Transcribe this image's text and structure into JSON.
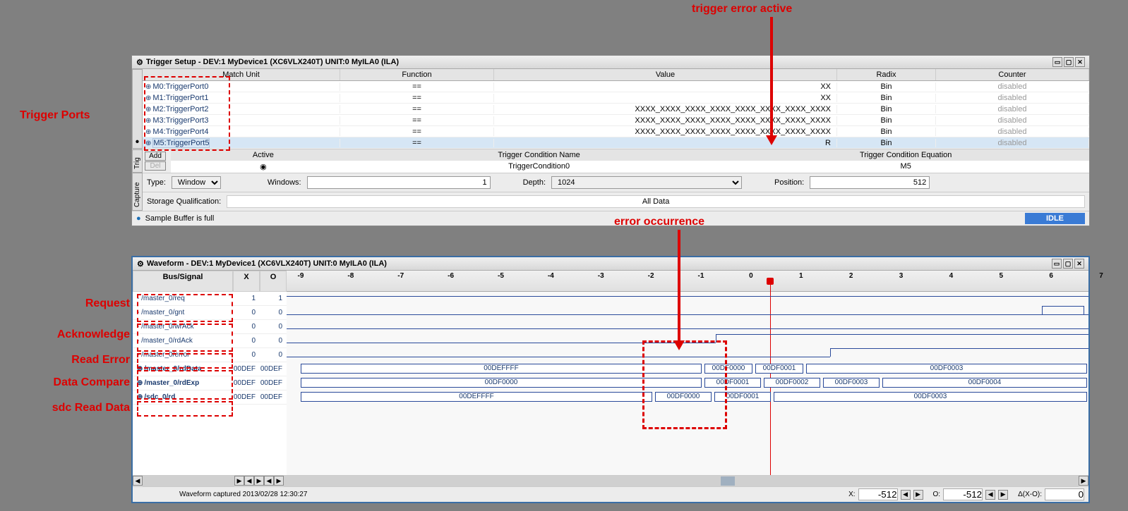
{
  "annotations": {
    "trigger_error": "trigger error active",
    "trigger_ports": "Trigger Ports",
    "error_occurrence": "error occurrence",
    "request": "Request",
    "acknowledge": "Acknowledge",
    "read_error": "Read Error",
    "data_compare": "Data Compare",
    "sdc_read_data": "sdc Read Data"
  },
  "trigger": {
    "title": "Trigger Setup - DEV:1 MyDevice1 (XC6VLX240T) UNIT:0 MyILA0 (ILA)",
    "headers": {
      "mu": "Match Unit",
      "fn": "Function",
      "val": "Value",
      "rx": "Radix",
      "cnt": "Counter"
    },
    "rows": [
      {
        "mu": "M0:TriggerPort0",
        "fn": "==",
        "val": "XX",
        "rx": "Bin",
        "cnt": "disabled"
      },
      {
        "mu": "M1:TriggerPort1",
        "fn": "==",
        "val": "XX",
        "rx": "Bin",
        "cnt": "disabled"
      },
      {
        "mu": "M2:TriggerPort2",
        "fn": "==",
        "val": "XXXX_XXXX_XXXX_XXXX_XXXX_XXXX_XXXX_XXXX",
        "rx": "Bin",
        "cnt": "disabled"
      },
      {
        "mu": "M3:TriggerPort3",
        "fn": "==",
        "val": "XXXX_XXXX_XXXX_XXXX_XXXX_XXXX_XXXX_XXXX",
        "rx": "Bin",
        "cnt": "disabled"
      },
      {
        "mu": "M4:TriggerPort4",
        "fn": "==",
        "val": "XXXX_XXXX_XXXX_XXXX_XXXX_XXXX_XXXX_XXXX",
        "rx": "Bin",
        "cnt": "disabled"
      },
      {
        "mu": "M5:TriggerPort5",
        "fn": "==",
        "val": "R",
        "rx": "Bin",
        "cnt": "disabled",
        "sel": true
      }
    ],
    "cond": {
      "add": "Add",
      "del": "Del",
      "h_active": "Active",
      "h_name": "Trigger Condition Name",
      "h_eq": "Trigger Condition Equation",
      "name": "TriggerCondition0",
      "eq": "M5"
    },
    "capture": {
      "type_lbl": "Type:",
      "type": "Window",
      "windows_lbl": "Windows:",
      "windows": "1",
      "depth_lbl": "Depth:",
      "depth": "1024",
      "position_lbl": "Position:",
      "position": "512",
      "storage_lbl": "Storage Qualification:",
      "storage": "All Data"
    },
    "tabs": {
      "trig": "Trig",
      "capture": "Capture"
    },
    "status": "Sample Buffer is full",
    "idle": "IDLE"
  },
  "waveform": {
    "title": "Waveform - DEV:1 MyDevice1 (XC6VLX240T) UNIT:0 MyILA0 (ILA)",
    "col_bus": "Bus/Signal",
    "col_x": "X",
    "col_o": "O",
    "signals": [
      {
        "name": "/master_0/req",
        "x": "1",
        "o": "1"
      },
      {
        "name": "/master_0/gnt",
        "x": "0",
        "o": "0"
      },
      {
        "name": "/master_0/wrAck",
        "x": "0",
        "o": "0"
      },
      {
        "name": "/master_0/rdAck",
        "x": "0",
        "o": "0"
      },
      {
        "name": "/master_0/error",
        "x": "0",
        "o": "0"
      },
      {
        "name": "/master_0/rdData",
        "x": "00DEF",
        "o": "00DEF",
        "bold": true
      },
      {
        "name": "/master_0/rdExp",
        "x": "00DEF",
        "o": "00DEF",
        "bold": true
      },
      {
        "name": "/sdc_0/rd",
        "x": "00DEF",
        "o": "00DEF",
        "bold": true
      }
    ],
    "ruler": [
      "-9",
      "-8",
      "-7",
      "-6",
      "-5",
      "-4",
      "-3",
      "-2",
      "-1",
      "0",
      "1",
      "2",
      "3",
      "4",
      "5",
      "6",
      "7"
    ],
    "bus_rdData": [
      "00DEFFFF",
      "00DF0000",
      "00DF0001",
      "00DF0003"
    ],
    "bus_rdExp": [
      "00DF0000",
      "00DF0001",
      "00DF0002",
      "00DF0003",
      "00DF0004"
    ],
    "bus_sdc": [
      "00DEFFFF",
      "00DF0000",
      "00DF0001",
      "00DF0003"
    ],
    "footer": {
      "captured": "Waveform captured 2013/02/28 12:30:27",
      "x_lbl": "X:",
      "x": "-512",
      "o_lbl": "O:",
      "o": "-512",
      "d_lbl": "Δ(X-O):",
      "d": "0"
    }
  }
}
